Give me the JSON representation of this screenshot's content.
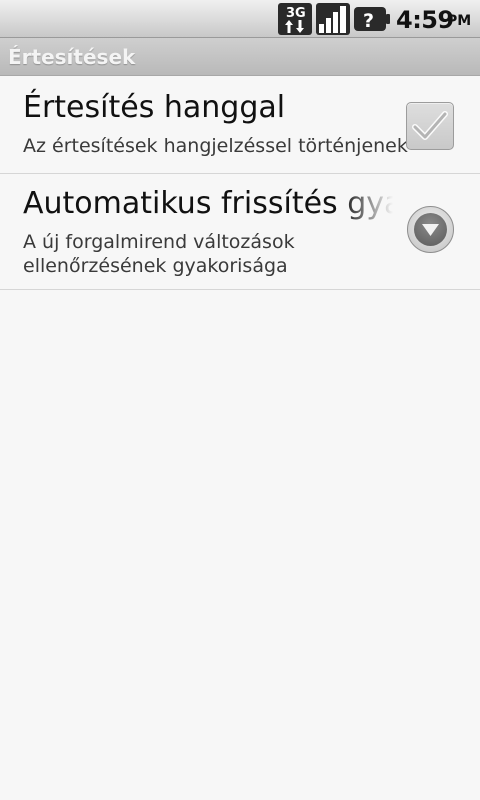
{
  "status_bar": {
    "network_icon": "3g-data-icon",
    "network_label": "3G",
    "signal_icon": "signal-strength-icon",
    "battery_icon": "battery-unknown-icon",
    "battery_symbol": "?",
    "time": "4:59",
    "ampm": "PM"
  },
  "title_bar": {
    "title": "Értesítések"
  },
  "preferences": [
    {
      "title": "Értesítés hanggal",
      "summary": "Az értesítések hangjelzéssel történjenek",
      "control": "checkbox",
      "checked": true,
      "icon": "checkmark-icon"
    },
    {
      "title": "Automatikus frissítés gyakorisága",
      "summary": "A új forgalmirend változások ellenőrzésének gyakorisága",
      "control": "dropdown",
      "icon": "dropdown-arrow-icon"
    }
  ],
  "colors": {
    "background": "#f7f7f7",
    "title_bar_text": "#f4f4f4",
    "divider": "#d6d6d6"
  }
}
